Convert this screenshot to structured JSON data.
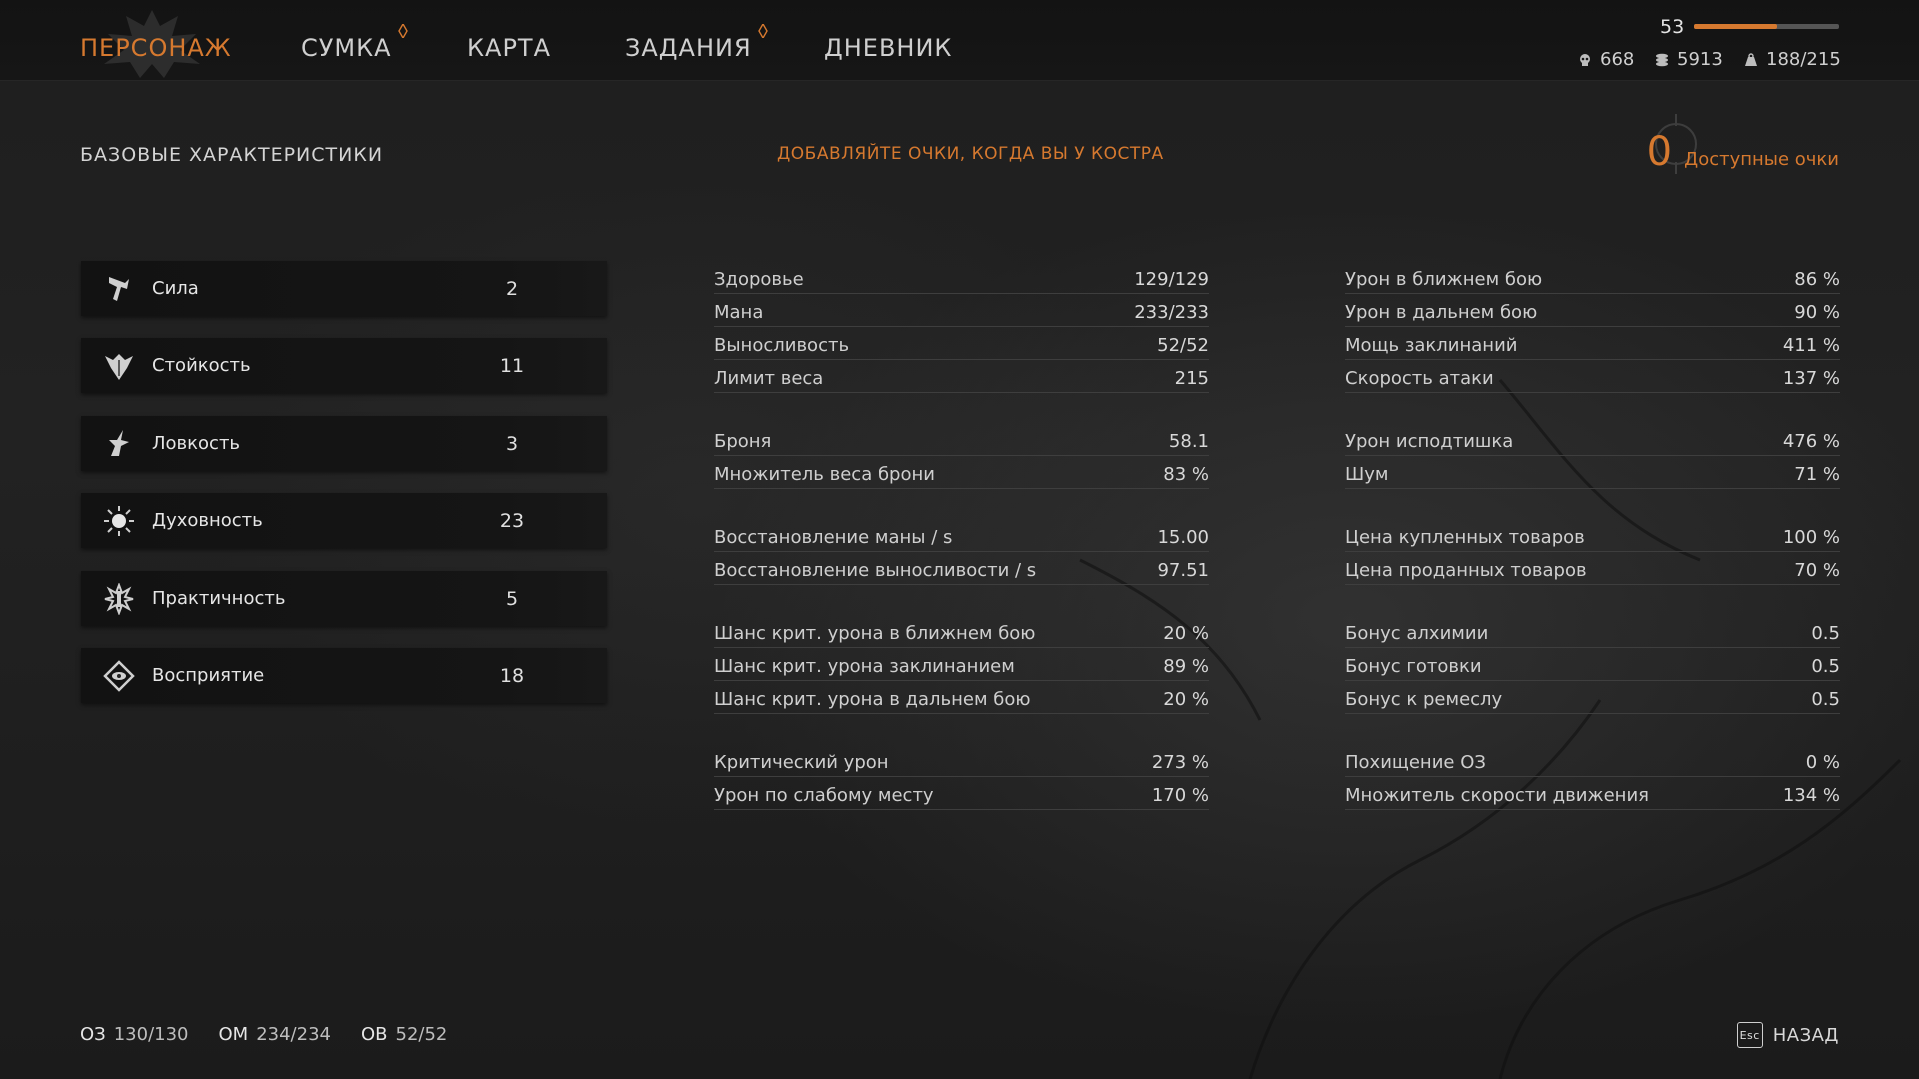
{
  "nav": {
    "tabs": [
      {
        "label": "ПЕРСОНАЖ",
        "active": true,
        "badge": false
      },
      {
        "label": "СУМКА",
        "active": false,
        "badge": true
      },
      {
        "label": "КАРТА",
        "active": false,
        "badge": false
      },
      {
        "label": "ЗАДАНИЯ",
        "active": false,
        "badge": true
      },
      {
        "label": "ДНЕВНИК",
        "active": false,
        "badge": false
      }
    ]
  },
  "status": {
    "level": "53",
    "xp_progress": 0.57,
    "skulls": "668",
    "gold": "5913",
    "weight": "188/215"
  },
  "header": {
    "section_title": "БАЗОВЫЕ ХАРАКТЕРИСТИКИ",
    "hint": "ДОБАВЛЯЙТЕ ОЧКИ, КОГДА ВЫ У КОСТРА",
    "available_points": "0",
    "available_points_label": "Доступные очки"
  },
  "attributes": [
    {
      "name": "Сила",
      "value": "2",
      "icon": "strength-icon"
    },
    {
      "name": "Стойкость",
      "value": "11",
      "icon": "constitution-icon"
    },
    {
      "name": "Ловкость",
      "value": "3",
      "icon": "agility-icon"
    },
    {
      "name": "Духовность",
      "value": "23",
      "icon": "spirituality-icon"
    },
    {
      "name": "Практичность",
      "value": "5",
      "icon": "practicality-icon"
    },
    {
      "name": "Восприятие",
      "value": "18",
      "icon": "perception-icon"
    }
  ],
  "stats_left": [
    {
      "label": "Здоровье",
      "value": "129/129"
    },
    {
      "label": "Мана",
      "value": "233/233"
    },
    {
      "label": "Выносливость",
      "value": "52/52"
    },
    {
      "label": "Лимит веса",
      "value": "215"
    },
    {
      "label": "Броня",
      "value": "58.1"
    },
    {
      "label": "Множитель веса брони",
      "value": "83 %"
    },
    {
      "label": "Восстановление маны / s",
      "value": "15.00"
    },
    {
      "label": "Восстановление выносливости / s",
      "value": "97.51"
    },
    {
      "label": "Шанс крит. урона в ближнем бою",
      "value": "20 %"
    },
    {
      "label": "Шанс крит. урона заклинанием",
      "value": "89 %"
    },
    {
      "label": "Шанс крит. урона в дальнем бою",
      "value": "20 %"
    },
    {
      "label": "Критический урон",
      "value": "273 %"
    },
    {
      "label": "Урон по слабому месту",
      "value": "170 %"
    }
  ],
  "stats_right": [
    {
      "label": "Урон в ближнем бою",
      "value": "86 %"
    },
    {
      "label": "Урон в дальнем бою",
      "value": "90 %"
    },
    {
      "label": "Мощь заклинаний",
      "value": "411 %"
    },
    {
      "label": "Скорость атаки",
      "value": "137 %"
    },
    {
      "label": "Урон исподтишка",
      "value": "476 %"
    },
    {
      "label": "Шум",
      "value": "71 %"
    },
    {
      "label": "Цена купленных товаров",
      "value": "100 %"
    },
    {
      "label": "Цена проданных товаров",
      "value": "70 %"
    },
    {
      "label": "Бонус алхимии",
      "value": "0.5"
    },
    {
      "label": "Бонус готовки",
      "value": "0.5"
    },
    {
      "label": "Бонус к ремеслу",
      "value": "0.5"
    },
    {
      "label": "Похищение ОЗ",
      "value": "0 %"
    },
    {
      "label": "Множитель скорости движения",
      "value": "134 %"
    }
  ],
  "footer": {
    "hp_label": "ОЗ",
    "hp_value": "130/130",
    "mp_label": "ОМ",
    "mp_value": "234/234",
    "sp_label": "ОВ",
    "sp_value": "52/52",
    "esc_key": "Esc",
    "back_label": "НАЗАД"
  },
  "colors": {
    "accent": "#d6792f",
    "text": "#d8d8d8",
    "background": "#1c1c1c"
  }
}
